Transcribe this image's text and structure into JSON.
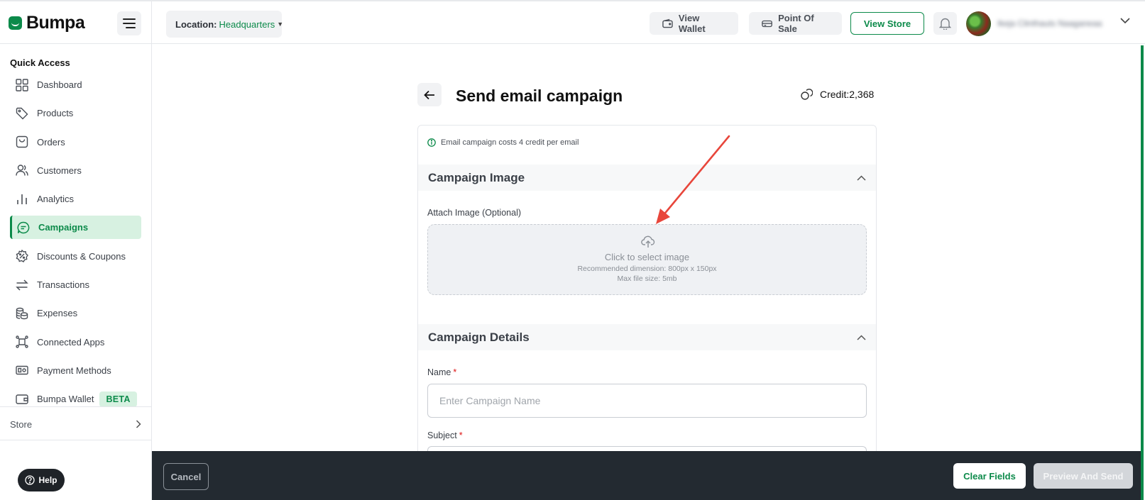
{
  "brand": {
    "name": "Bumpa"
  },
  "header": {
    "location_label": "Location:",
    "location_value": "Headquarters",
    "view_wallet": "View Wallet",
    "point_of_sale": "Point Of Sale",
    "view_store": "View Store",
    "username": "Ikeja Clinthauts Naaganeaa"
  },
  "sidebar": {
    "section_title": "Quick Access",
    "items": [
      {
        "label": "Dashboard",
        "icon": "grid-icon"
      },
      {
        "label": "Products",
        "icon": "tag-icon"
      },
      {
        "label": "Orders",
        "icon": "bag-icon"
      },
      {
        "label": "Customers",
        "icon": "users-icon"
      },
      {
        "label": "Analytics",
        "icon": "bar-chart-icon"
      },
      {
        "label": "Campaigns",
        "icon": "chat-icon",
        "active": true
      },
      {
        "label": "Discounts & Coupons",
        "icon": "percent-badge-icon"
      },
      {
        "label": "Transactions",
        "icon": "transfer-icon"
      },
      {
        "label": "Expenses",
        "icon": "coins-icon"
      },
      {
        "label": "Connected Apps",
        "icon": "apps-icon"
      },
      {
        "label": "Payment Methods",
        "icon": "cash-icon"
      },
      {
        "label": "Bumpa Wallet",
        "icon": "wallet-icon",
        "badge": "BETA"
      }
    ],
    "store_label": "Store",
    "help_label": "Help"
  },
  "main": {
    "title": "Send email campaign",
    "credit_text": "Credit:2,368",
    "info_text": "Email campaign costs 4 credit per email",
    "image_section": {
      "title": "Campaign Image",
      "attach_label": "Attach Image (Optional)",
      "drop_title": "Click to select image",
      "drop_hint_dimension": "Recommended dimension: 800px x 150px",
      "drop_hint_size": "Max file size: 5mb"
    },
    "details_section": {
      "title": "Campaign Details",
      "name_label": "Name",
      "name_placeholder": "Enter Campaign Name",
      "name_value": "",
      "subject_label": "Subject",
      "required_mark": "*"
    }
  },
  "footer": {
    "cancel": "Cancel",
    "clear_fields": "Clear Fields",
    "preview_and_send": "Preview And Send"
  },
  "colors": {
    "brand_green": "#0c8a4a",
    "active_bg": "#d7f1e1",
    "bottom_bar": "#232a31",
    "annotation_arrow": "#e8463b"
  }
}
